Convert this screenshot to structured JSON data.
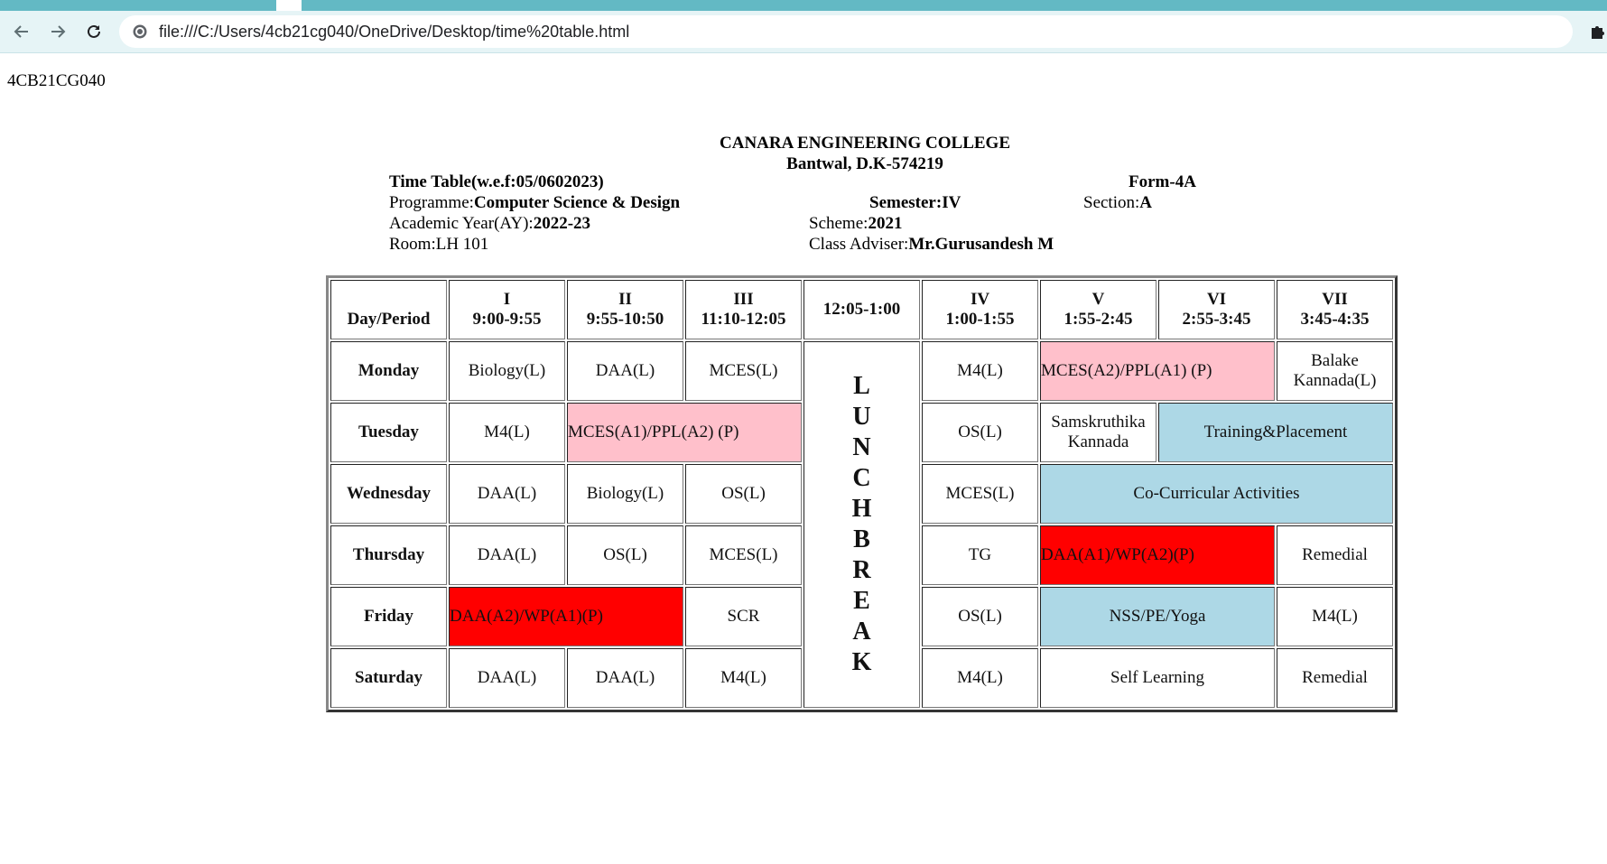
{
  "browser": {
    "url": "file:///C:/Users/4cb21cg040/OneDrive/Desktop/time%20table.html"
  },
  "page": {
    "usn": "4CB21CG040",
    "college_name": "CANARA ENGINEERING COLLEGE",
    "college_address": "Bantwal, D.K-574219",
    "time_table_label": "Time Table(w.e.f:05/0602023)",
    "form": "Form-4A",
    "programme_label": "Programme:",
    "programme_value": "Computer Science & Design",
    "semester_label": "Semester:",
    "semester_value": "IV",
    "section_label": "Section:",
    "section_value": "A",
    "ay_label": "Academic Year(AY):",
    "ay_value": "2022-23",
    "scheme_label": "Scheme:",
    "scheme_value": "2021",
    "room_label": "Room:LH 101",
    "adviser_label": "Class Adviser:",
    "adviser_value": "Mr.Gurusandesh M"
  },
  "table": {
    "header": {
      "day_period": "Day/Period",
      "p1_num": "I",
      "p1_time": "9:00-9:55",
      "p2_num": "II",
      "p2_time": "9:55-10:50",
      "p3_num": "III",
      "p3_time": "11:10-12:05",
      "lunch_time": "12:05-1:00",
      "p4_num": "IV",
      "p4_time": "1:00-1:55",
      "p5_num": "V",
      "p5_time": "1:55-2:45",
      "p6_num": "VI",
      "p6_time": "2:55-3:45",
      "p7_num": "VII",
      "p7_time": "3:45-4:35"
    },
    "lunch_letters": [
      "L",
      "U",
      "N",
      "C",
      "H",
      "B",
      "R",
      "E",
      "A",
      "K"
    ],
    "monday": {
      "day": "Monday",
      "p1": "Biology(L)",
      "p2": "DAA(L)",
      "p3": "MCES(L)",
      "p4": "M4(L)",
      "p5_6": "MCES(A2)/PPL(A1) (P)",
      "p7_a": "Balake",
      "p7_b": "Kannada(L)"
    },
    "tuesday": {
      "day": "Tuesday",
      "p1": "M4(L)",
      "p2_3": "MCES(A1)/PPL(A2) (P)",
      "p4": "OS(L)",
      "p5_a": "Samskruthika",
      "p5_b": "Kannada",
      "p6_7": "Training&Placement"
    },
    "wednesday": {
      "day": "Wednesday",
      "p1": "DAA(L)",
      "p2": "Biology(L)",
      "p3": "OS(L)",
      "p4": "MCES(L)",
      "p5_7": "Co-Curricular Activities"
    },
    "thursday": {
      "day": "Thursday",
      "p1": "DAA(L)",
      "p2": "OS(L)",
      "p3": "MCES(L)",
      "p4": "TG",
      "p5_6": "DAA(A1)/WP(A2)(P)",
      "p7": "Remedial"
    },
    "friday": {
      "day": "Friday",
      "p1_2": "DAA(A2)/WP(A1)(P)",
      "p3": "SCR",
      "p4": "OS(L)",
      "p5_6": "NSS/PE/Yoga",
      "p7": "M4(L)"
    },
    "saturday": {
      "day": "Saturday",
      "p1": "DAA(L)",
      "p2": "DAA(L)",
      "p3": "M4(L)",
      "p4": "M4(L)",
      "p5_6": "Self Learning",
      "p7": "Remedial"
    }
  },
  "colors": {
    "lab_pink": "#ffc0cb",
    "activity_blue": "#add8e6",
    "lab_red": "#ff0000",
    "browser_frame": "#63b9c4"
  },
  "icons": [
    "back-arrow-icon",
    "forward-arrow-icon",
    "reload-icon",
    "site-info-icon",
    "puzzle-extension-icon"
  ]
}
